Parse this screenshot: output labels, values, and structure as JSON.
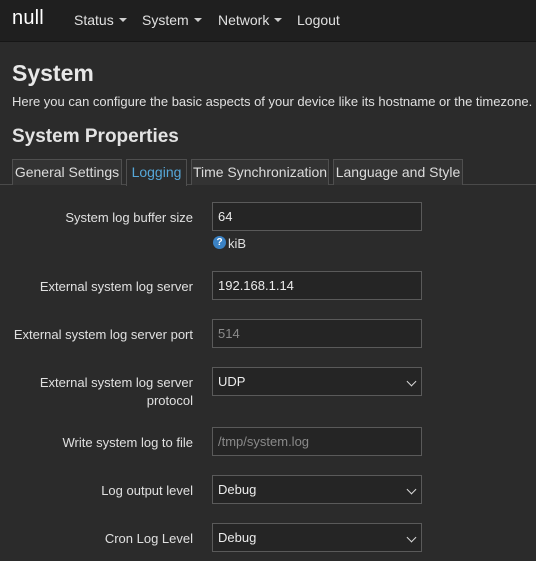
{
  "header": {
    "brand": "null",
    "nav": [
      {
        "label": "Status"
      },
      {
        "label": "System"
      },
      {
        "label": "Network"
      },
      {
        "label": "Logout"
      }
    ]
  },
  "page": {
    "title": "System",
    "description": "Here you can configure the basic aspects of your device like its hostname or the timezone.",
    "section_title": "System Properties"
  },
  "tabs": [
    {
      "label": "General Settings",
      "active": false
    },
    {
      "label": "Logging",
      "active": true
    },
    {
      "label": "Time Synchronization",
      "active": false
    },
    {
      "label": "Language and Style",
      "active": false
    }
  ],
  "form": {
    "log_buffer_size": {
      "label": "System log buffer size",
      "value": "64",
      "unit": "kiB",
      "help_icon": "question-circle-icon"
    },
    "log_server": {
      "label": "External system log server",
      "value": "192.168.1.14"
    },
    "log_server_port": {
      "label": "External system log server port",
      "placeholder": "514"
    },
    "log_server_protocol": {
      "label": "External system log server protocol",
      "selected": "UDP"
    },
    "log_file": {
      "label": "Write system log to file",
      "placeholder": "/tmp/system.log"
    },
    "log_output_level": {
      "label": "Log output level",
      "selected": "Debug"
    },
    "cron_log_level": {
      "label": "Cron Log Level",
      "selected": "Debug"
    }
  },
  "colors": {
    "background": "#2b2b2b",
    "header": "#1f1f1f",
    "active_tab_text": "#56a7d8",
    "help_icon": "#3b82c4"
  }
}
